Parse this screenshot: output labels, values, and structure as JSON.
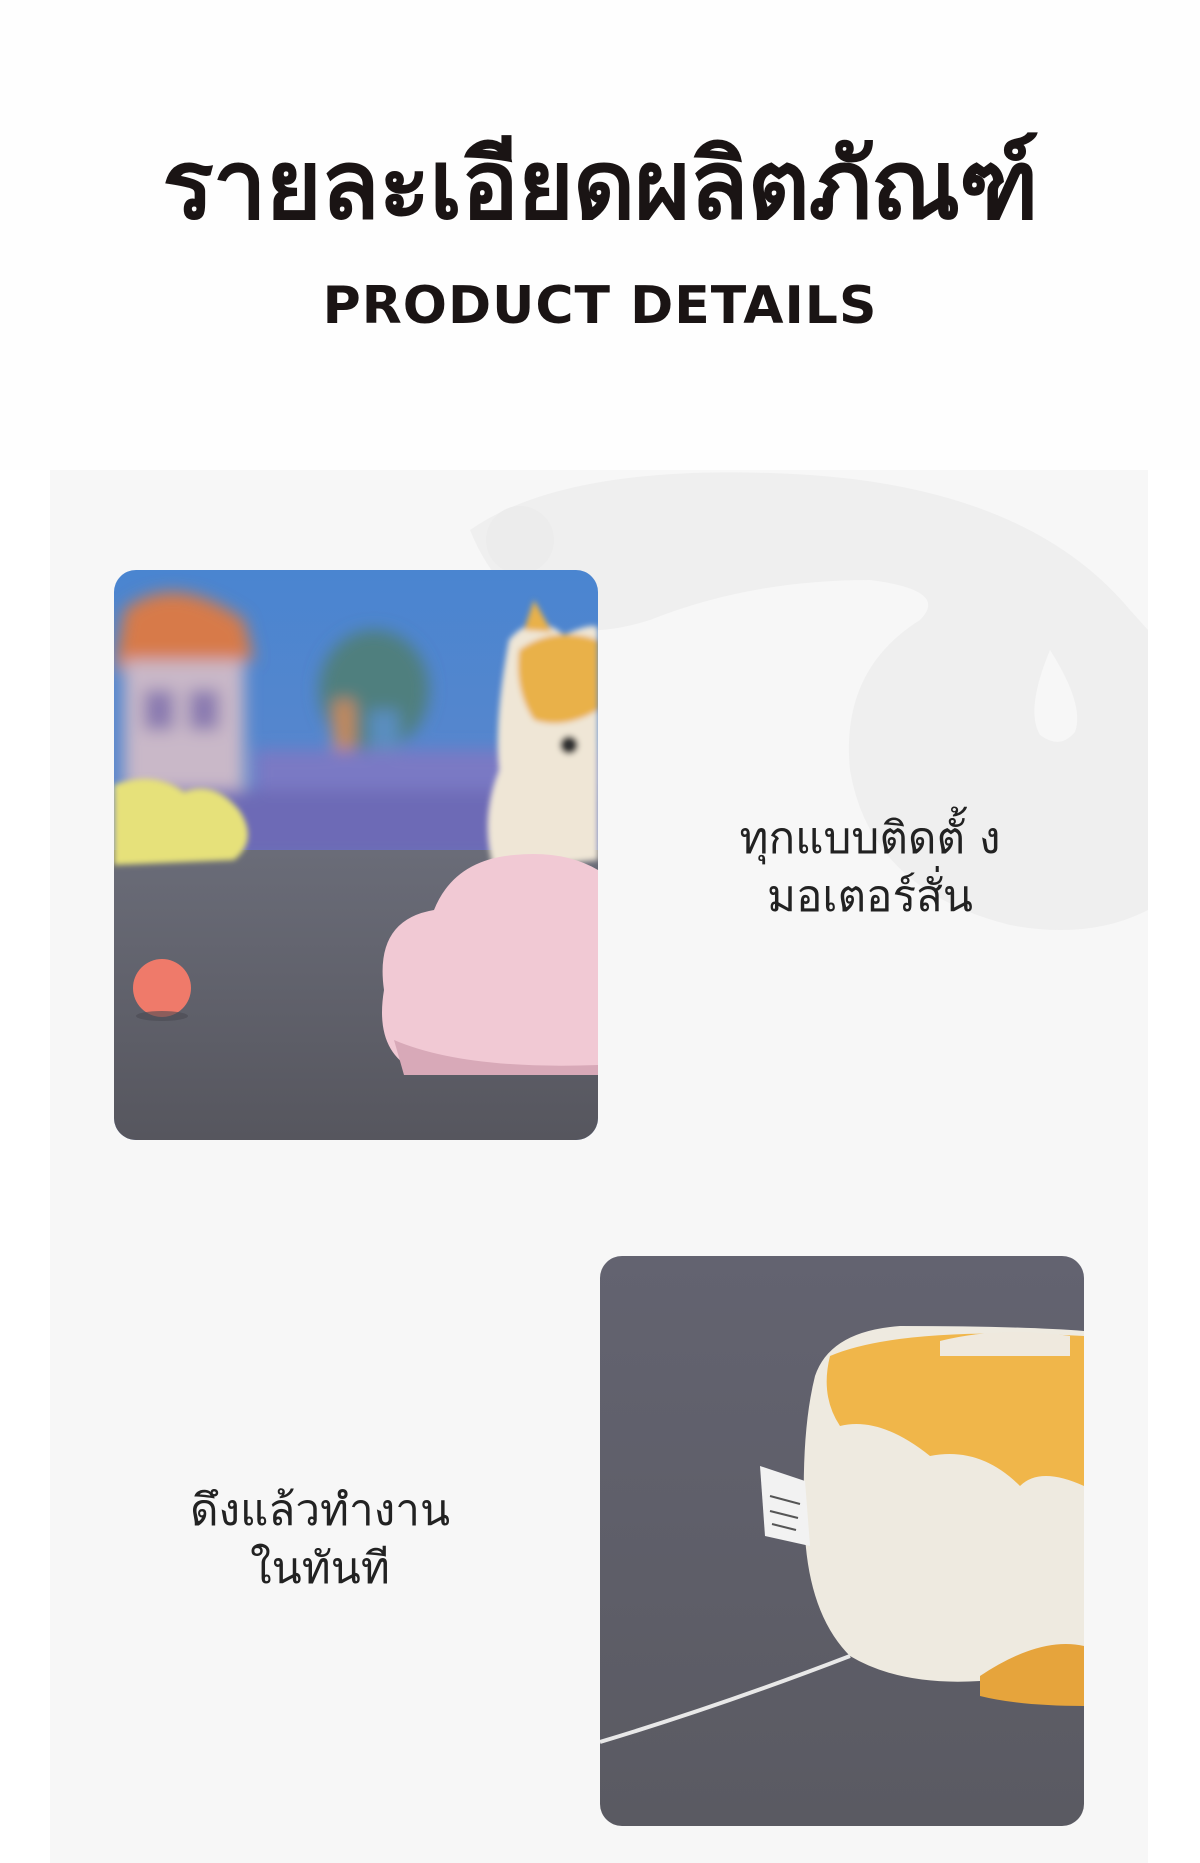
{
  "header": {
    "title_th": "รายละเอียดผลิตภัณฑ์",
    "title_en": "PRODUCT DETAILS"
  },
  "colors": {
    "title": "#1a1414",
    "panel_bg": "#f7f7f7",
    "caption_text": "#222222",
    "decor_shape": "#eeeeee"
  },
  "features": [
    {
      "image": "corgi-toy-scene-photo",
      "caption_lines": [
        "ทุกแบบติดตั้ ง",
        "มอเตอร์สั่น"
      ]
    },
    {
      "image": "pull-string-plush-toy-photo",
      "caption_lines": [
        "ดึงแล้วทำงาน",
        "ในทันที"
      ]
    }
  ]
}
